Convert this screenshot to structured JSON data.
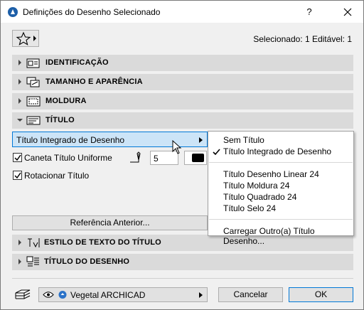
{
  "window": {
    "title": "Definições do Desenho Selecionado",
    "help_label": "?"
  },
  "header": {
    "selected_info": "Selecionado: 1 Editável: 1"
  },
  "sections": {
    "identificacao": "IDENTIFICAÇÃO",
    "tamanho": "TAMANHO E APARÊNCIA",
    "moldura": "MOLDURA",
    "titulo": "TÍTULO",
    "estilo": "ESTILO DE TEXTO DO TÍTULO",
    "titulo_desenho": "TÍTULO DO DESENHO"
  },
  "title_panel": {
    "type_value": "Título Integrado de Desenho",
    "uniform_pen_label": "Caneta Título Uniforme",
    "uniform_pen_checked": true,
    "pen_number": "5",
    "pen_color": "#000000",
    "rotate_label": "Rotacionar Título",
    "rotate_checked": true,
    "reference_button": "Referência Anterior..."
  },
  "dropdown": {
    "items": [
      "Sem Título",
      "Título Integrado de Desenho",
      "Título Desenho Linear 24",
      "Título Moldura 24",
      "Título Quadrado 24",
      "Título Selo 24",
      "Carregar Outro(a) Título Desenho..."
    ],
    "checked_item": "Título Integrado de Desenho"
  },
  "footer": {
    "layer_name": "Vegetal ARCHICAD",
    "cancel_label": "Cancelar",
    "ok_label": "OK"
  },
  "colors": {
    "section_bg": "#dadada",
    "accent": "#0078d7",
    "highlight": "#cce4f7"
  }
}
